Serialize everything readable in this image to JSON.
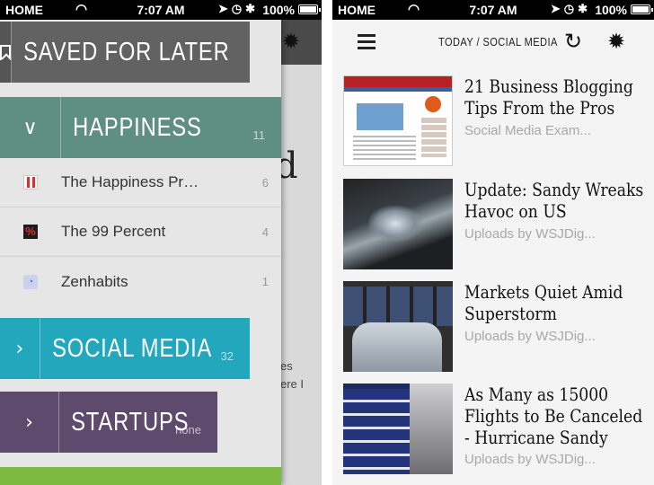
{
  "status_bar": {
    "carrier": "HOME",
    "time": "7:07 AM",
    "battery": "100%",
    "icons": [
      "location-icon",
      "clock-icon",
      "bluetooth-icon"
    ]
  },
  "left": {
    "background_article": {
      "big_letter": "d",
      "text_fragment_1": "es",
      "text_fragment_2": "ere I"
    },
    "drawer": {
      "categories": [
        {
          "label": "SAVED FOR LATER",
          "count": "",
          "color": "#626262"
        },
        {
          "label": "HAPPINESS",
          "count": "11",
          "color": "#5e8f80"
        },
        {
          "label": "SOCIAL MEDIA",
          "count": "32",
          "color": "#23a7bd"
        },
        {
          "label": "STARTUPS",
          "count": "none",
          "color": "#5e4a6d"
        },
        {
          "label": "",
          "count": "",
          "color": "#7cb941"
        }
      ],
      "feeds": [
        {
          "name": "The Happiness Pr…",
          "count": "6",
          "icon": "happiness-project-icon"
        },
        {
          "name": "The 99 Percent",
          "count": "4",
          "icon": "99-percent-icon"
        },
        {
          "name": "Zenhabits",
          "count": "1",
          "icon": "rss-icon"
        }
      ]
    }
  },
  "right": {
    "navbar": {
      "title": "TODAY / SOCIAL MEDIA"
    },
    "articles": [
      {
        "title": "21 Business Blogging Tips From the Pros",
        "source": "Social Media Exam..."
      },
      {
        "title": "Update: Sandy Wreaks Havoc on US",
        "source": "Uploads by WSJDig..."
      },
      {
        "title": "Markets Quiet Amid Superstorm",
        "source": "Uploads by WSJDig..."
      },
      {
        "title": "As Many as 15000 Flights to Be Canceled - Hurricane Sandy",
        "source": "Uploads by WSJDig..."
      }
    ]
  }
}
